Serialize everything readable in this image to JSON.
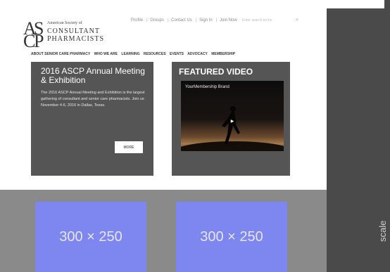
{
  "logo": {
    "letters": {
      "a": "A",
      "s": "S",
      "c": "C",
      "p": "P"
    },
    "line1": "American Society of",
    "line2": "CONSULTANT",
    "line3": "PHARMACISTS"
  },
  "top_links": [
    "Profile",
    "Groups",
    "Contact Us",
    "Sign In",
    "Join Now"
  ],
  "search": {
    "placeholder": "Enter search terms"
  },
  "nav": [
    "ABOUT SENIOR CARE PHARMACY",
    "WHO WE ARE",
    "LEARNING",
    "RESOURCES",
    "EVENTS",
    "ADVOCACY",
    "MEMBERSHIP"
  ],
  "event_card": {
    "title": "2016 ASCP Annual Meeting & Exhibition",
    "body": "The 2016 ASCP Annual Meeting and Exhibition is the largest gathering of consultant and senior care pharmacists. Join us November 4-6, 2016 in Dallas, Texas.",
    "button": "MORE"
  },
  "video_card": {
    "heading": "FEATURED VIDEO",
    "video_title": "YourMembership Brand",
    "play_glyph": "▶"
  },
  "ads": [
    "300 × 250",
    "300 × 250"
  ],
  "side_caption": "scale",
  "colors": {
    "card": "#555555",
    "ad": "#7e86f0",
    "banner": "#8a8a8a",
    "background": "#4a4a4a"
  }
}
